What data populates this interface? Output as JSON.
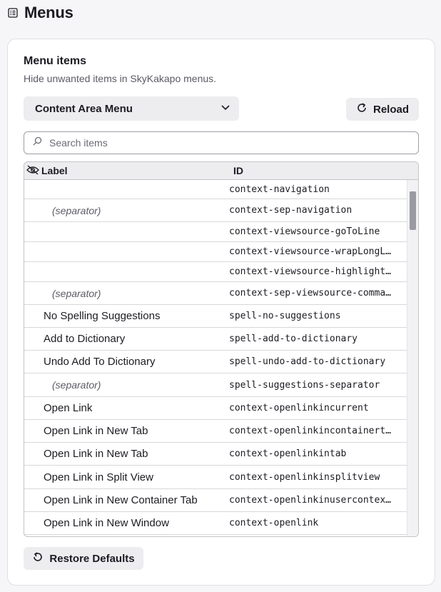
{
  "page": {
    "title": "Menus",
    "icon": "list-icon"
  },
  "card": {
    "title": "Menu items",
    "description": "Hide unwanted items in SkyKakapo menus."
  },
  "menu_select": {
    "value": "Content Area Menu",
    "icon": "chevron-down-icon"
  },
  "reload": {
    "label": "Reload",
    "icon": "reload-icon"
  },
  "search": {
    "placeholder": "Search items",
    "value": "",
    "icon": "search-icon"
  },
  "table": {
    "columns": {
      "label": "Label",
      "id": "ID",
      "label_icon": "eye-slash-icon"
    },
    "rows": [
      {
        "label": "",
        "id": "context-navigation",
        "separator": false
      },
      {
        "label": "(separator)",
        "id": "context-sep-navigation",
        "separator": true
      },
      {
        "label": "",
        "id": "context-viewsource-goToLine",
        "separator": false
      },
      {
        "label": "",
        "id": "context-viewsource-wrapLongL…",
        "separator": false
      },
      {
        "label": "",
        "id": "context-viewsource-highlight…",
        "separator": false
      },
      {
        "label": "(separator)",
        "id": "context-sep-viewsource-comma…",
        "separator": true
      },
      {
        "label": "No Spelling Suggestions",
        "id": "spell-no-suggestions",
        "separator": false
      },
      {
        "label": "Add to Dictionary",
        "id": "spell-add-to-dictionary",
        "separator": false
      },
      {
        "label": "Undo Add To Dictionary",
        "id": "spell-undo-add-to-dictionary",
        "separator": false
      },
      {
        "label": "(separator)",
        "id": "spell-suggestions-separator",
        "separator": true
      },
      {
        "label": "Open Link",
        "id": "context-openlinkincurrent",
        "separator": false
      },
      {
        "label": "Open Link in New Tab",
        "id": "context-openlinkincontainert…",
        "separator": false
      },
      {
        "label": "Open Link in New Tab",
        "id": "context-openlinkintab",
        "separator": false
      },
      {
        "label": "Open Link in Split View",
        "id": "context-openlinkinsplitview",
        "separator": false
      },
      {
        "label": "Open Link in New Container Tab",
        "id": "context-openlinkinusercontex…",
        "separator": false
      },
      {
        "label": "Open Link in New Window",
        "id": "context-openlink",
        "separator": false
      }
    ]
  },
  "restore": {
    "label": "Restore Defaults",
    "icon": "restore-icon"
  }
}
